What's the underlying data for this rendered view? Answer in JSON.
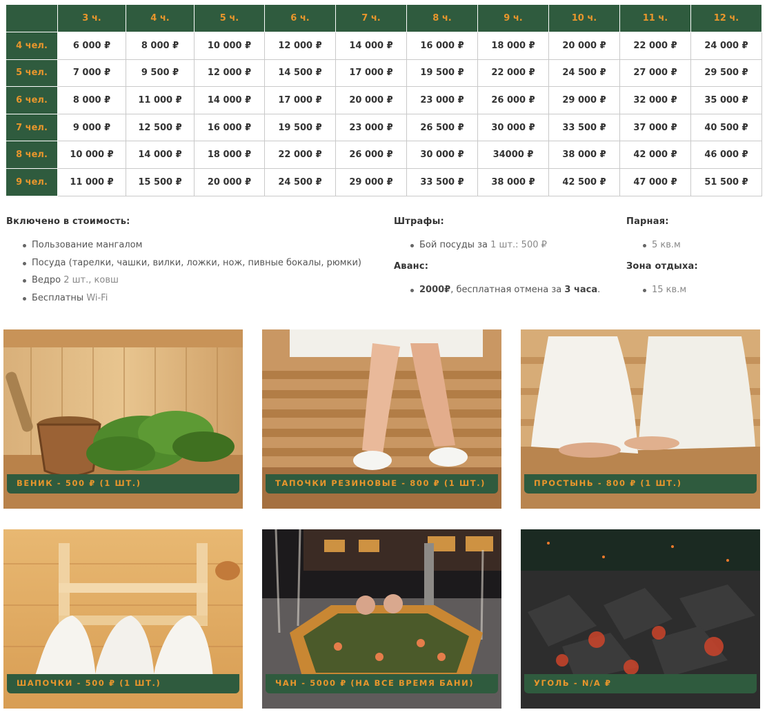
{
  "table": {
    "hours": [
      "3 ч.",
      "4 ч.",
      "5 ч.",
      "6 ч.",
      "7 ч.",
      "8 ч.",
      "9 ч.",
      "10 ч.",
      "11 ч.",
      "12 ч."
    ],
    "rows": [
      {
        "people": "4 чел.",
        "prices": [
          "6 000 ₽",
          "8 000 ₽",
          "10 000 ₽",
          "12 000 ₽",
          "14 000 ₽",
          "16 000 ₽",
          "18 000 ₽",
          "20 000 ₽",
          "22 000 ₽",
          "24 000 ₽"
        ]
      },
      {
        "people": "5 чел.",
        "prices": [
          "7 000 ₽",
          "9 500 ₽",
          "12 000 ₽",
          "14 500 ₽",
          "17 000 ₽",
          "19 500 ₽",
          "22 000 ₽",
          "24 500 ₽",
          "27 000 ₽",
          "29 500 ₽"
        ]
      },
      {
        "people": "6 чел.",
        "prices": [
          "8 000 ₽",
          "11 000 ₽",
          "14 000 ₽",
          "17 000 ₽",
          "20 000 ₽",
          "23 000 ₽",
          "26 000 ₽",
          "29 000 ₽",
          "32 000 ₽",
          "35 000 ₽"
        ]
      },
      {
        "people": "7 чел.",
        "prices": [
          "9 000 ₽",
          "12 500 ₽",
          "16 000 ₽",
          "19 500 ₽",
          "23 000 ₽",
          "26 500 ₽",
          "30 000 ₽",
          "33 500 ₽",
          "37 000 ₽",
          "40 500 ₽"
        ]
      },
      {
        "people": "8 чел.",
        "prices": [
          "10 000 ₽",
          "14 000 ₽",
          "18 000 ₽",
          "22 000 ₽",
          "26 000 ₽",
          "30 000 ₽",
          "34000 ₽",
          "38 000 ₽",
          "42 000 ₽",
          "46 000 ₽"
        ]
      },
      {
        "people": "9 чел.",
        "prices": [
          "11 000 ₽",
          "15 500 ₽",
          "20 000 ₽",
          "24 500 ₽",
          "29 000 ₽",
          "33 500 ₽",
          "38 000 ₽",
          "42 500 ₽",
          "47 000 ₽",
          "51 500 ₽"
        ]
      }
    ]
  },
  "included": {
    "title": "Включено в стоимость:",
    "items": [
      {
        "text": "Пользование мангалом",
        "muted": ""
      },
      {
        "text": "Посуда (тарелки, чашки, вилки, ложки, нож, пивные бокалы, рюмки)",
        "muted": ""
      },
      {
        "text": "Ведро ",
        "muted": "2 шт., ковш"
      },
      {
        "text": "Бесплатны ",
        "muted": "Wi-Fi"
      }
    ]
  },
  "fines": {
    "title": "Штрафы:",
    "item_text": "Бой посуды за ",
    "item_muted": "1 шт.: 500 ₽"
  },
  "advance": {
    "title": "Аванс:",
    "amount": "2000₽",
    "text": ", бесплатная отмена за ",
    "hours": "3 часа",
    "end": "."
  },
  "steam_room": {
    "title": "Парная:",
    "area": "5 кв.м"
  },
  "rest_zone": {
    "title": "Зона отдыха:",
    "area": "15 кв.м"
  },
  "gallery": [
    {
      "label": "Веник - 500 ₽ (1 шт.)"
    },
    {
      "label": "Тапочки резиновые - 800 ₽ (1 шт.)"
    },
    {
      "label": "Простынь - 800 ₽ (1 шт.)"
    },
    {
      "label": "Шапочки - 500 ₽ (1 шт.)"
    },
    {
      "label": "Чан - 5000 ₽ (на все время бани)"
    },
    {
      "label": "Уголь - N/A ₽"
    }
  ],
  "colors": {
    "header_green": "#2f5b3e",
    "accent_orange": "#e8962c"
  }
}
